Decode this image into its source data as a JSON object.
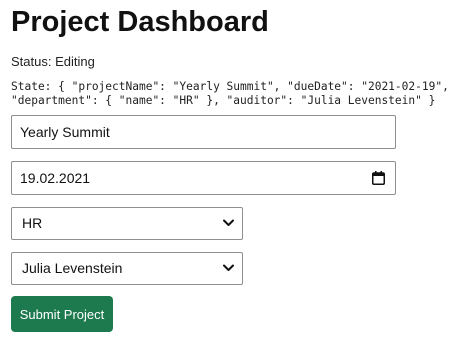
{
  "page": {
    "title": "Project Dashboard",
    "status_label": "Status:",
    "status_value": "Editing",
    "state_line_1": "State: { \"projectName\": \"Yearly Summit\", \"dueDate\": \"2021-02-19\",",
    "state_line_2": "\"department\": { \"name\": \"HR\" }, \"auditor\": \"Julia Levenstein\" }"
  },
  "form": {
    "project_name": "Yearly Summit",
    "due_date": "19.02.2021",
    "department": "HR",
    "auditor": "Julia Levenstein",
    "submit_label": "Submit Project"
  },
  "icons": {
    "date_picker": "calendar-icon",
    "select_arrow": "chevron-down-icon"
  },
  "colors": {
    "submit_background": "#1d7a4f",
    "submit_text": "#ffffff",
    "field_border": "#8f8f8f"
  }
}
